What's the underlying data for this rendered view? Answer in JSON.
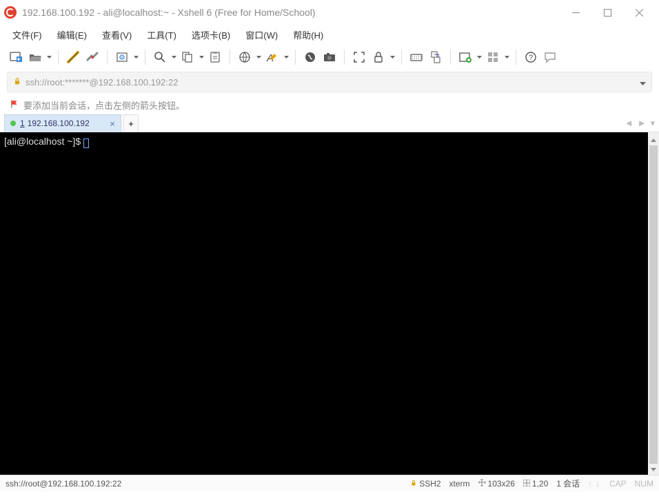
{
  "window": {
    "title": "192.168.100.192 - ali@localhost:~ - Xshell 6 (Free for Home/School)"
  },
  "menu": {
    "file": "文件(F)",
    "edit": "编辑(E)",
    "view": "查看(V)",
    "tools": "工具(T)",
    "tabs": "选项卡(B)",
    "window": "窗口(W)",
    "help": "帮助(H)"
  },
  "address": {
    "url": "ssh://root:*******@192.168.100.192:22"
  },
  "hint": {
    "text": "要添加当前会话，点击左侧的箭头按钮。"
  },
  "tab": {
    "index": "1",
    "label": "192.168.100.192"
  },
  "addtab": {
    "plus": "+"
  },
  "terminal": {
    "prompt": "[ali@localhost ~]$ "
  },
  "status": {
    "conn": "ssh://root@192.168.100.192:22",
    "proto": "SSH2",
    "term": "xterm",
    "size": "103x26",
    "enc": "1,20",
    "sess_num": "1",
    "sess": "会话",
    "cap": "CAP",
    "num": "NUM"
  }
}
